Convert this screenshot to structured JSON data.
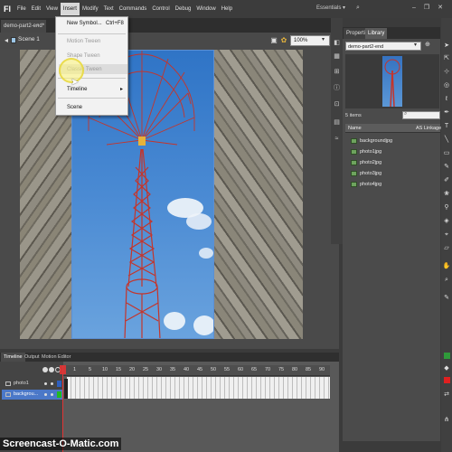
{
  "app": {
    "logo": "Fl",
    "workspace": "Essentials ▾"
  },
  "menubar": [
    "File",
    "Edit",
    "View",
    "Insert",
    "Modify",
    "Text",
    "Commands",
    "Control",
    "Debug",
    "Window",
    "Help"
  ],
  "window_controls": {
    "minimize": "–",
    "restore": "❐",
    "close": "✕"
  },
  "document": {
    "tab_label": "demo-part2-end*",
    "tab_close": "×",
    "scene": "Scene 1",
    "zoom": "100%"
  },
  "insert_menu": {
    "new_symbol": "New Symbol...",
    "new_symbol_shortcut": "Ctrl+F8",
    "motion_tween": "Motion Tween",
    "shape_tween": "Shape Tween",
    "classic_tween": "Classic Tween",
    "timeline": "Timeline",
    "scene": "Scene"
  },
  "panel": {
    "tab_properties": "Properties",
    "tab_library": "Library",
    "library_document": "demo-part2-end",
    "item_count": "5 items",
    "col_name": "Name",
    "col_linkage": "AS Linkage",
    "items": [
      "backgroundjpg",
      "photo1jpg",
      "photo2jpg",
      "photo3jpg",
      "photo4jpg"
    ]
  },
  "timeline": {
    "tabs": [
      "Timeline",
      "Output",
      "Motion Editor"
    ],
    "ruler": [
      "1",
      "5",
      "10",
      "15",
      "20",
      "25",
      "30",
      "35",
      "40",
      "45",
      "50",
      "55",
      "60",
      "65",
      "70",
      "75",
      "80",
      "85",
      "90"
    ],
    "layers": [
      {
        "name": "photo1",
        "color": "#2e5fbf"
      },
      {
        "name": "backgrou...",
        "color": "#22b922"
      }
    ]
  },
  "watermark": "Screencast-O-Matic.com"
}
